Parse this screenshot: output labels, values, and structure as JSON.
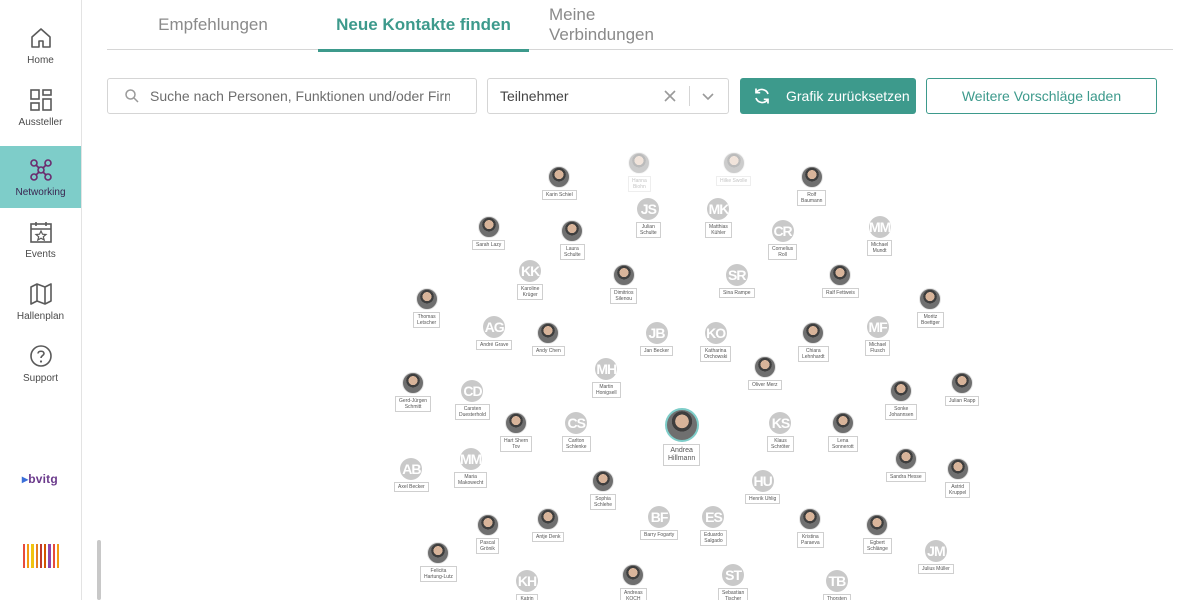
{
  "sidebar": {
    "items": [
      {
        "label": "Home"
      },
      {
        "label": "Aussteller"
      },
      {
        "label": "Networking"
      },
      {
        "label": "Events"
      },
      {
        "label": "Hallenplan"
      },
      {
        "label": "Support"
      }
    ],
    "logo_text": "bvitg",
    "accent": "#7ecdc9"
  },
  "tabs": [
    {
      "label": "Empfehlungen"
    },
    {
      "label": "Neue Kontakte finden"
    },
    {
      "label": "Meine Verbindungen"
    }
  ],
  "toolbar": {
    "search_placeholder": "Suche nach Personen, Funktionen und/oder Firmen",
    "filter_value": "Teilnehmer",
    "reset_label": "Grafik zurücksetzen",
    "more_label": "Weitere Vorschläge laden",
    "primary_color": "#3d9a8c"
  },
  "graph": {
    "center": {
      "name": "Andrea\nHillmann"
    },
    "nodes": [
      {
        "name": "Hanna\nBiohn",
        "initials": "",
        "faded": true
      },
      {
        "name": "Hilke Swolle",
        "initials": "",
        "faded": true
      },
      {
        "name": "Karin Schiel",
        "initials": ""
      },
      {
        "name": "Rolf\nBaumann",
        "initials": ""
      },
      {
        "name": "Julian\nSchulte",
        "initials": "JS"
      },
      {
        "name": "Matthias\nKühler",
        "initials": "MK"
      },
      {
        "name": "Sarah Lazy",
        "initials": ""
      },
      {
        "name": "Laura\nSchulte",
        "initials": ""
      },
      {
        "name": "Cornelius\nRoll",
        "initials": "CR"
      },
      {
        "name": "Michael\nMundt",
        "initials": "MM"
      },
      {
        "name": "Karoline\nKrüger",
        "initials": "KK"
      },
      {
        "name": "Dimitrios\nSilenou",
        "initials": ""
      },
      {
        "name": "Sina Rampe",
        "initials": "SR"
      },
      {
        "name": "Ralf Fettweis",
        "initials": ""
      },
      {
        "name": "Thomas\nLetscher",
        "initials": ""
      },
      {
        "name": "Moritz\nBoettger",
        "initials": ""
      },
      {
        "name": "André Grave",
        "initials": "AG"
      },
      {
        "name": "Andy Chen",
        "initials": ""
      },
      {
        "name": "Jan Becker",
        "initials": "JB"
      },
      {
        "name": "Katharina\nOrchowski",
        "initials": "KO"
      },
      {
        "name": "Chiara\nLehnhardt",
        "initials": ""
      },
      {
        "name": "Michael\nFlusch",
        "initials": "MF"
      },
      {
        "name": "Martin\nHonigsell",
        "initials": "MH"
      },
      {
        "name": "Oliver Merz",
        "initials": ""
      },
      {
        "name": "Gerd-Jürgen\nSchmitt",
        "initials": ""
      },
      {
        "name": "Carsten\nDuesterhold",
        "initials": "CD"
      },
      {
        "name": "Sonke\nJohannsen",
        "initials": ""
      },
      {
        "name": "Julian Rapp",
        "initials": ""
      },
      {
        "name": "Hart Shern\nTov",
        "initials": ""
      },
      {
        "name": "Carlton\nSchlenke",
        "initials": "CS"
      },
      {
        "name": "Klaus\nSchröter",
        "initials": "KS"
      },
      {
        "name": "Lena\nSonnerott",
        "initials": ""
      },
      {
        "name": "Axel Becker",
        "initials": "AB"
      },
      {
        "name": "Maria\nMakowecht",
        "initials": "MM"
      },
      {
        "name": "Sophia\nSchlehe",
        "initials": ""
      },
      {
        "name": "Henrik Uhlig",
        "initials": "HU"
      },
      {
        "name": "Sandra Hesse",
        "initials": ""
      },
      {
        "name": "Astrid\nKruppel",
        "initials": ""
      },
      {
        "name": "Pascal\nGrönik",
        "initials": ""
      },
      {
        "name": "Antje Denk",
        "initials": ""
      },
      {
        "name": "Barry Fogarty",
        "initials": "BF"
      },
      {
        "name": "Eduardo\nSalgado",
        "initials": "ES"
      },
      {
        "name": "Kristina\nParaeva",
        "initials": ""
      },
      {
        "name": "Egbert\nSchlänge",
        "initials": ""
      },
      {
        "name": "Felicita\nHartung-Lutz",
        "initials": ""
      },
      {
        "name": "Julius Müller",
        "initials": "JM"
      },
      {
        "name": "Katrin\nHeinz",
        "initials": "KH"
      },
      {
        "name": "Andreas\nKOCH",
        "initials": ""
      },
      {
        "name": "Sebastian\nTischer",
        "initials": "ST"
      },
      {
        "name": "Thorsten\nBecker",
        "initials": "TB"
      }
    ]
  }
}
